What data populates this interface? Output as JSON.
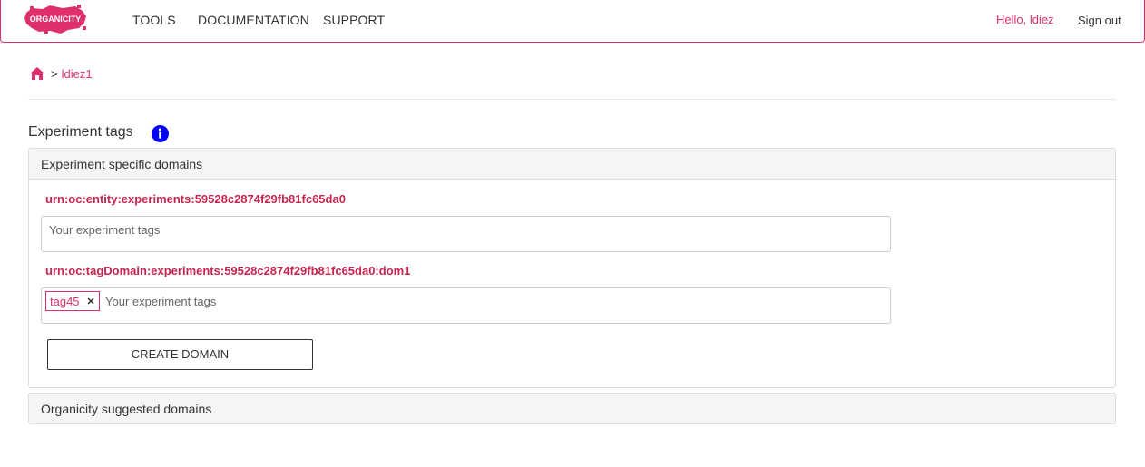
{
  "brand": {
    "logo_text": "ORGANICITY",
    "color": "#e0306b"
  },
  "nav": {
    "links": [
      {
        "label": "TOOLS"
      },
      {
        "label": "DOCUMENTATION"
      },
      {
        "label": "SUPPORT"
      }
    ],
    "greeting": "Hello, ldiez",
    "signout": "Sign out"
  },
  "breadcrumb": {
    "home_icon": "home-icon",
    "separator": ">",
    "current": "ldiez1"
  },
  "section": {
    "title": "Experiment tags",
    "info_icon": "info-icon"
  },
  "panel": {
    "heading": "Experiment specific domains",
    "domains": [
      {
        "urn": "urn:oc:entity:experiments:59528c2874f29fb81fc65da0",
        "tags": [],
        "placeholder": "Your experiment tags"
      },
      {
        "urn": "urn:oc:tagDomain:experiments:59528c2874f29fb81fc65da0:dom1",
        "tags": [
          "tag45"
        ],
        "placeholder": "Your experiment tags"
      }
    ],
    "create_button": "CREATE DOMAIN"
  },
  "suggested_panel": {
    "heading": "Organicity suggested domains"
  },
  "colors": {
    "accent": "#e0306b",
    "urn": "#c7254e",
    "info": "#0000ff"
  }
}
